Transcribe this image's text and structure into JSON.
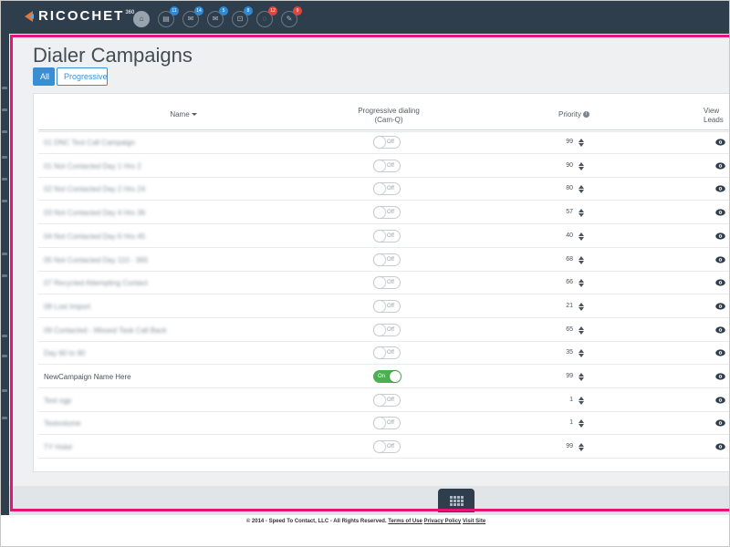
{
  "app": {
    "logo_text": "RICOCHET",
    "logo_sup": "360"
  },
  "topbar": {
    "icons": [
      {
        "name": "home",
        "badge": "",
        "badge_color": ""
      },
      {
        "name": "list",
        "badge": "11",
        "badge_color": "#2c8ad8"
      },
      {
        "name": "chat",
        "badge": "14",
        "badge_color": "#2c8ad8"
      },
      {
        "name": "mail",
        "badge": "5",
        "badge_color": "#2c8ad8"
      },
      {
        "name": "inbox",
        "badge": "8",
        "badge_color": "#2c8ad8"
      },
      {
        "name": "comment",
        "badge": "12",
        "badge_color": "#e0463c"
      },
      {
        "name": "tag",
        "badge": "9",
        "badge_color": "#e0463c"
      }
    ]
  },
  "page": {
    "title": "Dialer Campaigns",
    "filters": {
      "all": "All",
      "progressive": "Progressive"
    }
  },
  "table": {
    "headers": {
      "name": "Name",
      "progressive_line1": "Progressive dialing",
      "progressive_line2": "(Cam-Q)",
      "priority": "Priority",
      "view_line1": "View",
      "view_line2": "Leads"
    },
    "rows": [
      {
        "name": "01 DNC Text Call Campaign",
        "blurred": true,
        "toggle": "Off",
        "on": false,
        "priority": "99"
      },
      {
        "name": "01 Not Contacted Day 1 Hrs 2",
        "blurred": true,
        "toggle": "Off",
        "on": false,
        "priority": "90"
      },
      {
        "name": "02 Not Contacted Day 2 Hrs 24",
        "blurred": true,
        "toggle": "Off",
        "on": false,
        "priority": "80"
      },
      {
        "name": "03 Not Contacted Day 4 Hrs 36",
        "blurred": true,
        "toggle": "Off",
        "on": false,
        "priority": "57"
      },
      {
        "name": "04 Not Contacted Day 6 Hrs 45",
        "blurred": true,
        "toggle": "Off",
        "on": false,
        "priority": "40"
      },
      {
        "name": "05 Not Contacted Day 110 - 365",
        "blurred": true,
        "toggle": "Off",
        "on": false,
        "priority": "68"
      },
      {
        "name": "07 Recycled Attempting Contact",
        "blurred": true,
        "toggle": "Off",
        "on": false,
        "priority": "66"
      },
      {
        "name": "08 Lost Import",
        "blurred": true,
        "toggle": "Off",
        "on": false,
        "priority": "21"
      },
      {
        "name": "09 Contacted - Missed Task Call Back",
        "blurred": true,
        "toggle": "Off",
        "on": false,
        "priority": "65"
      },
      {
        "name": "Day 60 to 90",
        "blurred": true,
        "toggle": "Off",
        "on": false,
        "priority": "35"
      },
      {
        "name": "NewCampaign Name Here",
        "blurred": false,
        "toggle": "On",
        "on": true,
        "priority": "99"
      },
      {
        "name": "Test ogp",
        "blurred": true,
        "toggle": "Off",
        "on": false,
        "priority": "1"
      },
      {
        "name": "Testvolume",
        "blurred": true,
        "toggle": "Off",
        "on": false,
        "priority": "1"
      },
      {
        "name": "TY Hotel",
        "blurred": true,
        "toggle": "Off",
        "on": false,
        "priority": "99"
      }
    ]
  },
  "footer": {
    "copyright": "© 2014 - Speed To Contact, LLC - All Rights Reserved.",
    "terms": "Terms of Use",
    "privacy": "Privacy Policy",
    "visit": "Visit Site"
  },
  "colors": {
    "topbar": "#2f3e4c",
    "accent": "#3a8fd4",
    "toggle_on": "#4cb052",
    "highlight": "#e8127c"
  }
}
